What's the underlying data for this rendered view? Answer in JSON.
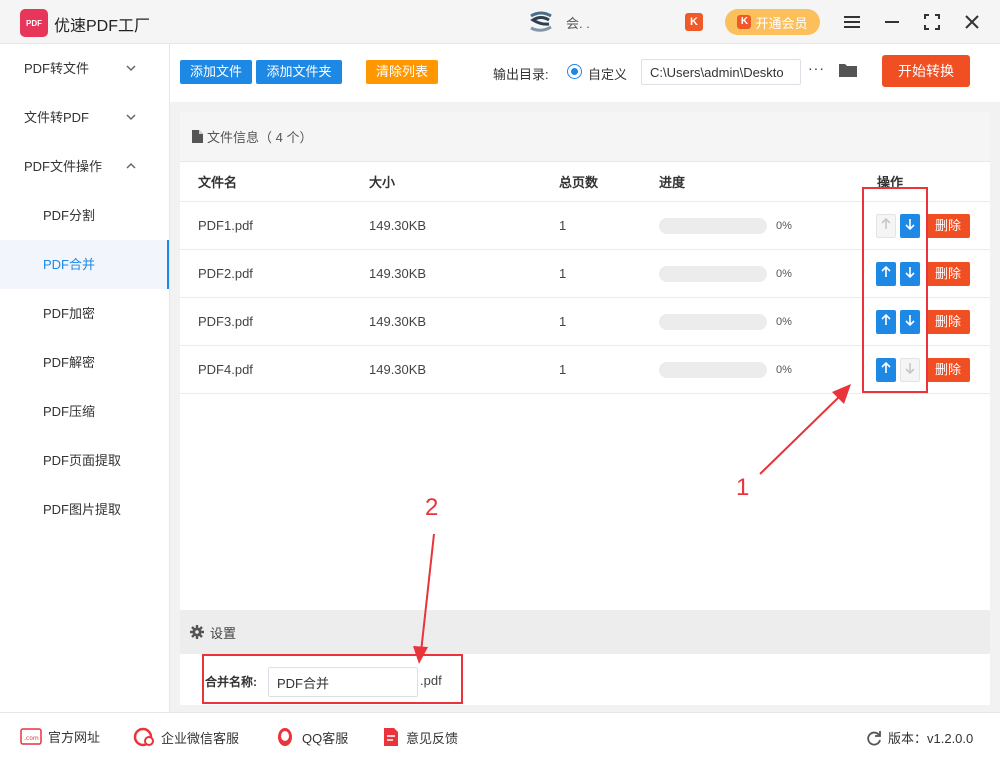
{
  "app": {
    "title": "优速PDF工厂",
    "logo_text": "PDF",
    "user_name": "会. .",
    "vip_label": "开通会员",
    "vip_mark": "K"
  },
  "sidebar": {
    "groups": [
      {
        "label": "PDF转文件"
      },
      {
        "label": "文件转PDF"
      },
      {
        "label": "PDF文件操作"
      }
    ],
    "subitems": [
      {
        "label": "PDF分割"
      },
      {
        "label": "PDF合并",
        "active": true
      },
      {
        "label": "PDF加密"
      },
      {
        "label": "PDF解密"
      },
      {
        "label": "PDF压缩"
      },
      {
        "label": "PDF页面提取"
      },
      {
        "label": "PDF图片提取"
      }
    ]
  },
  "toolbar": {
    "add_file": "添加文件",
    "add_folder": "添加文件夹",
    "clear_list": "清除列表",
    "output_label": "输出目录:",
    "radio_label": "自定义",
    "output_path": "C:\\Users\\admin\\Deskto",
    "more": "···",
    "start": "开始转换"
  },
  "files_panel": {
    "header": "文件信息（ 4 个）",
    "columns": {
      "name": "文件名",
      "size": "大小",
      "pages": "总页数",
      "progress": "进度",
      "ops": "操作"
    },
    "rows": [
      {
        "name": "PDF1.pdf",
        "size": "149.30KB",
        "pages": "1",
        "progress_text": "0%",
        "progress": 0,
        "up_enabled": false,
        "down_enabled": true,
        "delete": "删除"
      },
      {
        "name": "PDF2.pdf",
        "size": "149.30KB",
        "pages": "1",
        "progress_text": "0%",
        "progress": 0,
        "up_enabled": true,
        "down_enabled": true,
        "delete": "删除"
      },
      {
        "name": "PDF3.pdf",
        "size": "149.30KB",
        "pages": "1",
        "progress_text": "0%",
        "progress": 0,
        "up_enabled": true,
        "down_enabled": true,
        "delete": "删除"
      },
      {
        "name": "PDF4.pdf",
        "size": "149.30KB",
        "pages": "1",
        "progress_text": "0%",
        "progress": 0,
        "up_enabled": true,
        "down_enabled": false,
        "delete": "删除"
      }
    ]
  },
  "settings": {
    "header": "设置",
    "merge_label": "合并名称:",
    "merge_value": "PDF合并",
    "merge_ext": ".pdf"
  },
  "annotations": {
    "one": "1",
    "two": "2"
  },
  "footer": {
    "website": "官方网址",
    "website_icon_text": ".com",
    "wechat": "企业微信客服",
    "qq": "QQ客服",
    "feedback": "意见反馈",
    "version": "版本：v1.2.0.0"
  },
  "colors": {
    "primary": "#1e88e5",
    "danger": "#f04e23",
    "warning": "#ff9800",
    "annotation": "#e8343a"
  }
}
